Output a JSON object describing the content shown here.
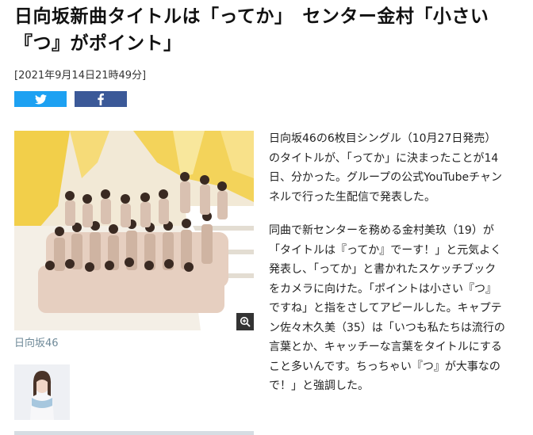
{
  "headline": "日向坂新曲タイトルは「ってか」　センター金村「小さい『つ』がポイント」",
  "timestamp": "[2021年9月14日21時49分]",
  "share": {
    "twitter_icon": "twitter-icon",
    "facebook_icon": "facebook-icon"
  },
  "photo": {
    "caption": "日向坂46",
    "zoom_icon": "zoom-in-icon"
  },
  "article": {
    "paragraphs": [
      "日向坂46の6枚目シングル（10月27日発売）のタイトルが、「ってか」に決まったことが14日、分かった。グループの公式YouTubeチャンネルで行った生配信で発表した。",
      "同曲で新センターを務める金村美玖（19）が「タイトルは『ってか』でーす！」と元気よく発表し、「ってか」と書かれたスケッチブックをカメラに向けた。「ポイントは小さい『つ』ですね」と指をさしてアピールした。キャプテン佐々木久美（35）は「いつも私たちは流行の言葉とか、キャッチーな言葉をタイトルにすること多いんです。ちっちゃい『つ』が大事なので！」と強調した。"
    ]
  },
  "colors": {
    "twitter": "#1da1f2",
    "facebook": "#3b5998",
    "caption": "#6f8a99"
  }
}
